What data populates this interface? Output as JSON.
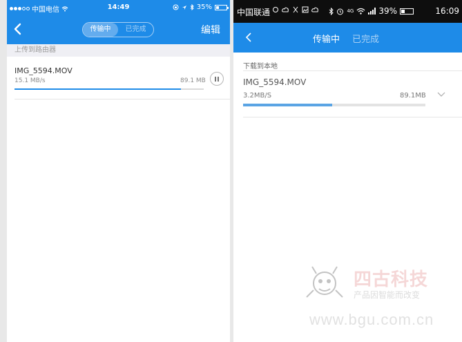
{
  "left_phone": {
    "status_bar": {
      "carrier": "中国电信",
      "wifi_icon": "wifi-icon",
      "time": "14:49",
      "battery_percent": "35%",
      "battery_level": 0.35
    },
    "nav": {
      "back_icon": "chevron-left-icon",
      "tabs": [
        {
          "label": "传输中",
          "active": true
        },
        {
          "label": "已完成",
          "active": false
        }
      ],
      "edit_label": "编辑"
    },
    "section_title": "上传到路由器",
    "transfers": [
      {
        "file_name": "IMG_5594.MOV",
        "speed": "15.1 MB/s",
        "size": "89.1 MB",
        "progress": 0.88,
        "action_icon": "pause-icon"
      }
    ]
  },
  "right_phone": {
    "status_bar": {
      "carrier": "中国联通",
      "battery_percent": "39%",
      "battery_level": 0.39,
      "time": "16:09",
      "network_label": "4G"
    },
    "nav": {
      "back_icon": "chevron-left-icon",
      "tabs": [
        {
          "label": "传输中",
          "active": true
        },
        {
          "label": "已完成",
          "active": false
        }
      ]
    },
    "section_title": "下载到本地",
    "transfers": [
      {
        "file_name": "IMG_5594.MOV",
        "speed": "3.2MB/S",
        "size": "89.1MB",
        "progress": 0.49,
        "action_icon": "chevron-down-icon"
      }
    ]
  },
  "watermark": {
    "brand": "四古科技",
    "tagline": "产品因智能而改变",
    "url": "www.bgu.com.cn",
    "brand_color": "#d9534f"
  },
  "colors": {
    "accent": "#1e8be8",
    "progress_ios": "#1e8be8",
    "progress_android": "#5aa4e4"
  }
}
